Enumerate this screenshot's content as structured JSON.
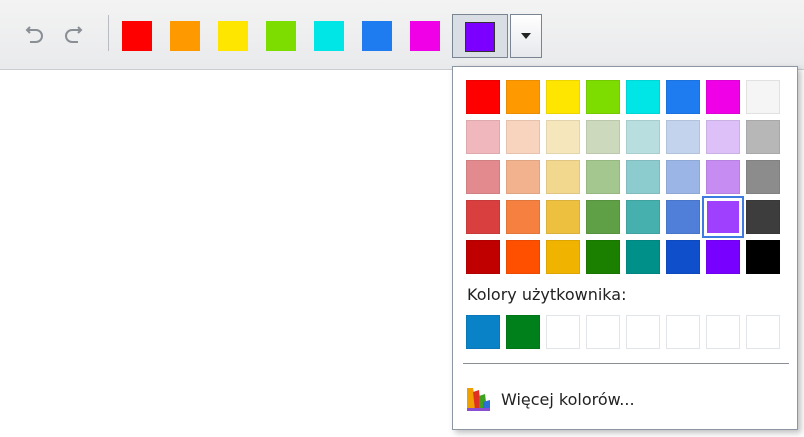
{
  "toolbar": {
    "undo_icon": "undo-icon",
    "redo_icon": "redo-icon",
    "swatches": [
      "#ff0000",
      "#ff9900",
      "#ffe600",
      "#7ddc00",
      "#00e6e6",
      "#1e7cf0",
      "#f000e6"
    ],
    "selected_color": "#7b00ff"
  },
  "palette": {
    "rows": [
      [
        "#ff0000",
        "#ff9900",
        "#ffe600",
        "#7ddc00",
        "#00e6e6",
        "#1e7cf0",
        "#f000e6",
        "#f5f5f5"
      ],
      [
        "#f0b8bc",
        "#f8d3bd",
        "#f6e6bb",
        "#cdd9bd",
        "#b8dee0",
        "#c3d3ee",
        "#dcc0f7",
        "#b7b7b7"
      ],
      [
        "#e28a8e",
        "#f2b28e",
        "#f2d78e",
        "#a3c78e",
        "#8ccbce",
        "#9bb6e6",
        "#c78cf2",
        "#8c8c8c"
      ],
      [
        "#d93f3f",
        "#f58040",
        "#eec040",
        "#5f9f45",
        "#45b0ad",
        "#4f7fd8",
        "#a040ff",
        "#3d3d3d"
      ],
      [
        "#c00000",
        "#ff5000",
        "#f0b400",
        "#1b7f00",
        "#00908a",
        "#0f4fcc",
        "#7800ff",
        "#000000"
      ]
    ],
    "selected_row": 3,
    "selected_col": 6,
    "custom_label": "Kolory użytkownika:",
    "custom_colors": [
      "#0a82c8",
      "#00801a",
      "",
      "",
      "",
      "",
      "",
      ""
    ],
    "more_colors_label": "Więcej kolorów...",
    "more_colors_icon": "palette-icon"
  }
}
